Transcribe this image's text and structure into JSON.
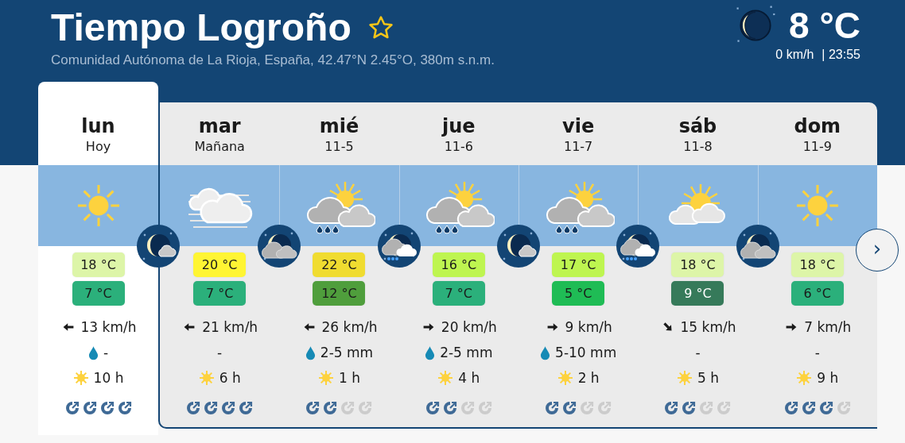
{
  "header": {
    "title": "Tiempo Logroño",
    "favorite": false,
    "subtitle": "Comunidad Autónoma de La Rioja, España, 42.47°N 2.45°O, 380m s.n.m.",
    "temperature": "8 °C",
    "wind": "0 km/h",
    "time": "| 23:55"
  },
  "days": [
    {
      "name": "lun",
      "sub": "Hoy",
      "selected": true,
      "weather": {
        "kind": "sun"
      },
      "max": {
        "text": "18 °C",
        "color": "#ddf5a8"
      },
      "min": {
        "text": "7 °C",
        "color": "#2bb07b"
      },
      "wind_arrow": {
        "kind": "west"
      },
      "wind": "13 km/h",
      "rain_drop": true,
      "rain": "-",
      "sun": "10 h",
      "rating": [
        {
          "active": true
        },
        {
          "active": true
        },
        {
          "active": true
        },
        {
          "active": true
        }
      ]
    },
    {
      "name": "mar",
      "sub": "Mañana",
      "selected": false,
      "weather": {
        "kind": "fog"
      },
      "max": {
        "text": "20 °C",
        "color": "#fff533"
      },
      "min": {
        "text": "7 °C",
        "color": "#2bb07b"
      },
      "wind_arrow": {
        "kind": "west"
      },
      "wind": "21 km/h",
      "rain_drop": false,
      "rain": "-",
      "sun": "6 h",
      "rating": [
        {
          "active": true
        },
        {
          "active": true
        },
        {
          "active": true
        },
        {
          "active": true
        }
      ]
    },
    {
      "name": "mié",
      "sub": "11-5",
      "selected": false,
      "weather": {
        "kind": "rain"
      },
      "max": {
        "text": "22 °C",
        "color": "#f0dc30"
      },
      "min": {
        "text": "12 °C",
        "color": "#4f9e3c"
      },
      "wind_arrow": {
        "kind": "west"
      },
      "wind": "26 km/h",
      "rain_drop": true,
      "rain": "2-5 mm",
      "sun": "1 h",
      "rating": [
        {
          "active": true
        },
        {
          "active": true
        },
        {
          "active": false
        },
        {
          "active": false
        }
      ]
    },
    {
      "name": "jue",
      "sub": "11-6",
      "selected": false,
      "weather": {
        "kind": "rain"
      },
      "max": {
        "text": "16 °C",
        "color": "#bef550"
      },
      "min": {
        "text": "7 °C",
        "color": "#2bb07b"
      },
      "wind_arrow": {
        "kind": "east"
      },
      "wind": "20 km/h",
      "rain_drop": true,
      "rain": "2-5 mm",
      "sun": "4 h",
      "rating": [
        {
          "active": true
        },
        {
          "active": true
        },
        {
          "active": false
        },
        {
          "active": false
        }
      ]
    },
    {
      "name": "vie",
      "sub": "11-7",
      "selected": false,
      "weather": {
        "kind": "rain"
      },
      "max": {
        "text": "17 °C",
        "color": "#bef550"
      },
      "min": {
        "text": "5 °C",
        "color": "#1fbc55"
      },
      "wind_arrow": {
        "kind": "east"
      },
      "wind": "9 km/h",
      "rain_drop": true,
      "rain": "5-10 mm",
      "sun": "2 h",
      "rating": [
        {
          "active": true
        },
        {
          "active": true
        },
        {
          "active": false
        },
        {
          "active": false
        }
      ]
    },
    {
      "name": "sáb",
      "sub": "11-8",
      "selected": false,
      "weather": {
        "kind": "sun_cloud"
      },
      "max": {
        "text": "18 °C",
        "color": "#ddf5a8"
      },
      "min": {
        "text": "9 °C",
        "color": "#367a5a"
      },
      "wind_arrow": {
        "kind": "southeast"
      },
      "wind": "15 km/h",
      "rain_drop": false,
      "rain": "-",
      "sun": "5 h",
      "rating": [
        {
          "active": true
        },
        {
          "active": true
        },
        {
          "active": false
        },
        {
          "active": false
        }
      ]
    },
    {
      "name": "dom",
      "sub": "11-9",
      "selected": false,
      "weather": {
        "kind": "sun"
      },
      "max": {
        "text": "18 °C",
        "color": "#ddf5a8"
      },
      "min": {
        "text": "6 °C",
        "color": "#2bb07b"
      },
      "wind_arrow": {
        "kind": "east"
      },
      "wind": "7 km/h",
      "rain_drop": false,
      "rain": "-",
      "sun": "9 h",
      "rating": [
        {
          "active": true
        },
        {
          "active": true
        },
        {
          "active": true
        },
        {
          "active": false
        }
      ]
    }
  ],
  "nights": [
    {
      "kind": "moon_cloud"
    },
    {
      "kind": "cloud_moon"
    },
    {
      "kind": "rain_moon"
    },
    {
      "kind": "moon_cloud"
    },
    {
      "kind": "rain_moon"
    },
    {
      "kind": "cloud_moon"
    }
  ],
  "next_button": {
    "label": "›"
  }
}
